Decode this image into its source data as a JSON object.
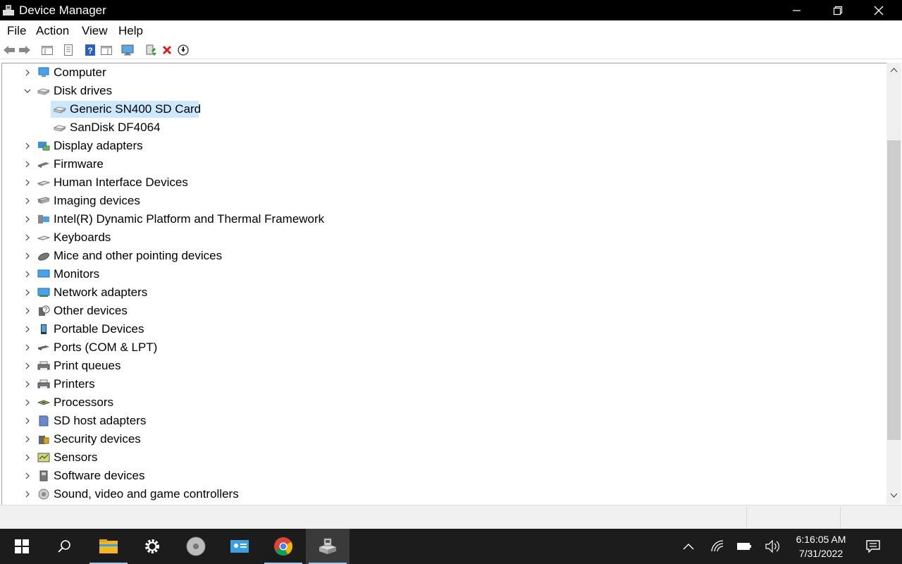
{
  "window": {
    "title": "Device Manager"
  },
  "menu": {
    "file": "File",
    "action": "Action",
    "view": "View",
    "help": "Help"
  },
  "tree": {
    "computer": "Computer",
    "disk_drives": "Disk drives",
    "disk_children": [
      "Generic SN400 SD Card",
      "SanDisk DF4064"
    ],
    "display_adapters": "Display adapters",
    "firmware": "Firmware",
    "hid": "Human Interface Devices",
    "imaging": "Imaging devices",
    "intel": "Intel(R) Dynamic Platform and Thermal Framework",
    "keyboards": "Keyboards",
    "mice": "Mice and other pointing devices",
    "monitors": "Monitors",
    "network": "Network adapters",
    "other": "Other devices",
    "portable": "Portable Devices",
    "ports": "Ports (COM & LPT)",
    "print_queues": "Print queues",
    "printers": "Printers",
    "processors": "Processors",
    "sd_host": "SD host adapters",
    "security": "Security devices",
    "sensors": "Sensors",
    "software": "Software devices",
    "sound": "Sound, video and game controllers"
  },
  "taskbar": {
    "time": "6:16:05 AM",
    "date": "7/31/2022"
  },
  "colors": {
    "selection": "#cce8ff",
    "titlebar": "#000000",
    "taskbar": "#1c1c1c"
  }
}
